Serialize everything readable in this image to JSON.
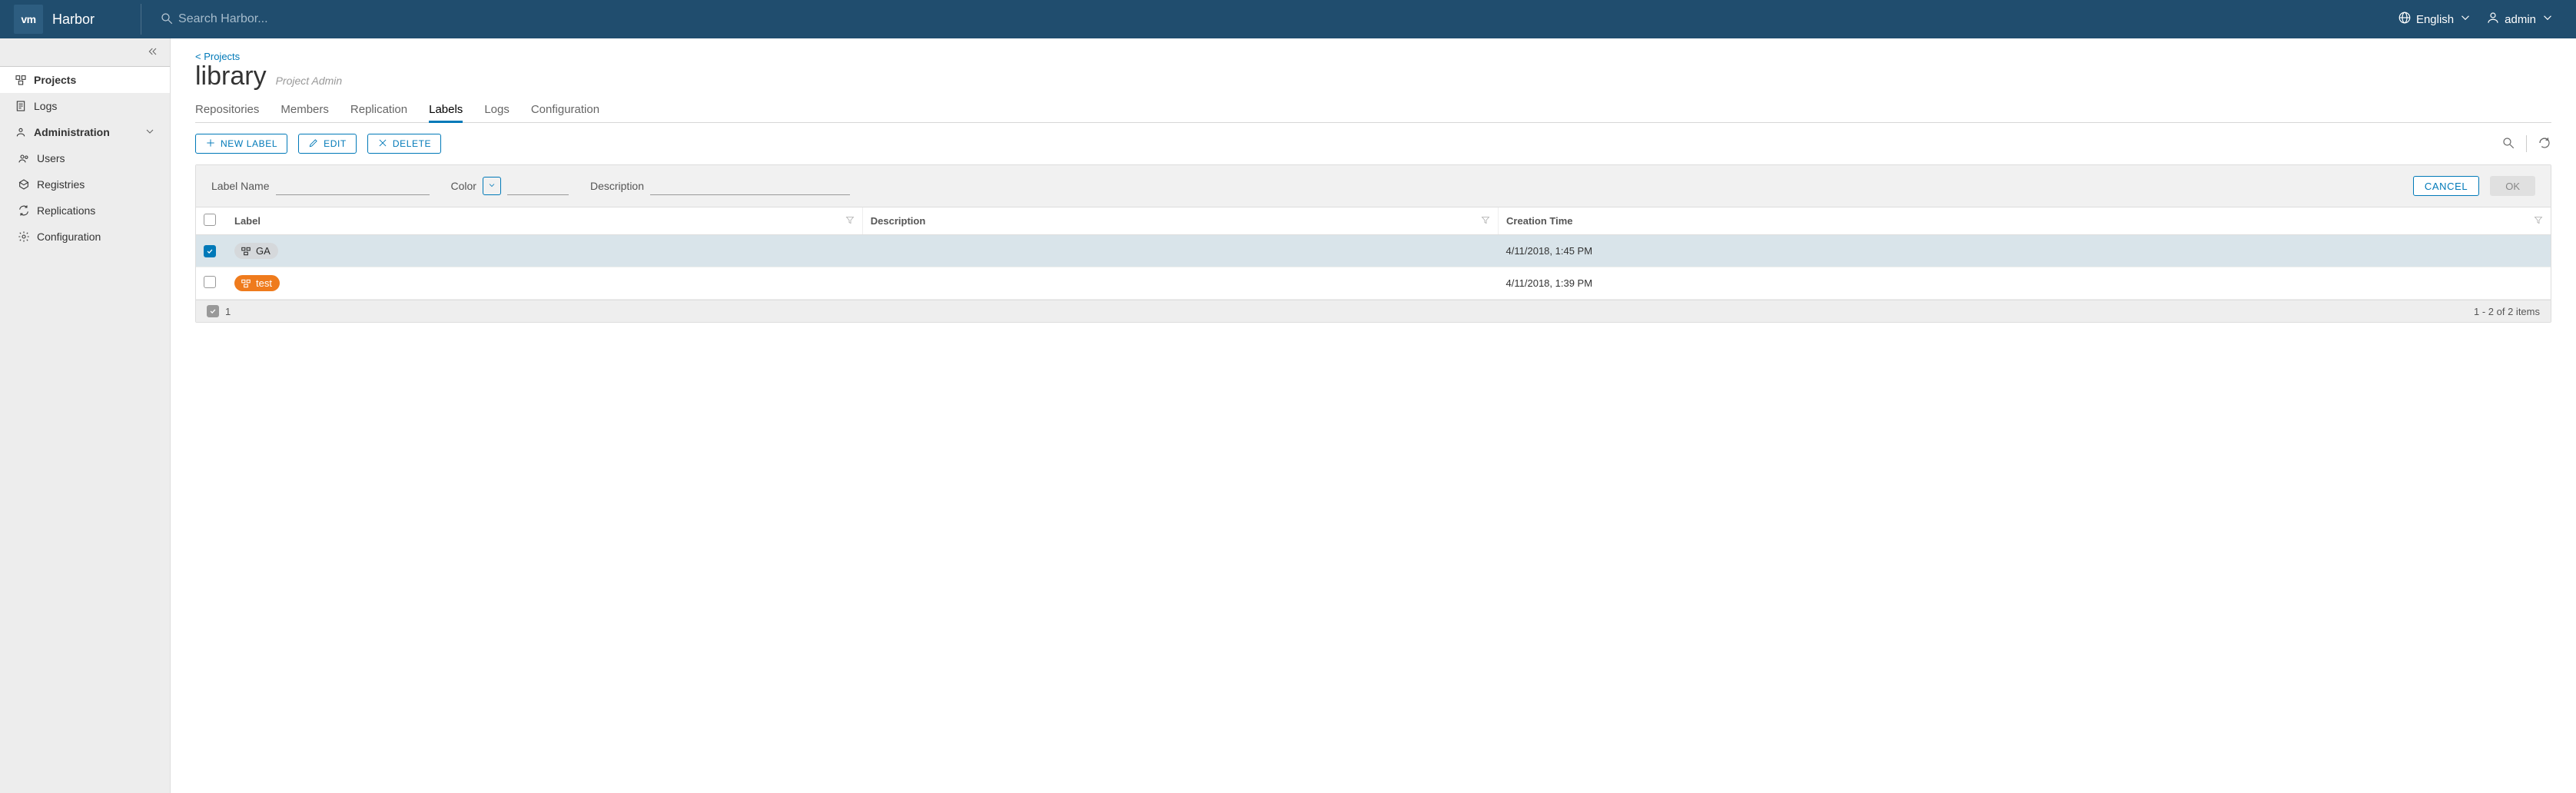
{
  "header": {
    "brand_logo_text": "vm",
    "app_name": "Harbor",
    "search_placeholder": "Search Harbor...",
    "language_label": "English",
    "user_label": "admin"
  },
  "sidebar": {
    "projects": "Projects",
    "logs": "Logs",
    "admin_label": "Administration",
    "users": "Users",
    "registries": "Registries",
    "replications": "Replications",
    "configuration": "Configuration"
  },
  "breadcrumb": {
    "back_projects": "< Projects"
  },
  "project": {
    "name": "library",
    "role": "Project Admin"
  },
  "tabs": {
    "repositories": "Repositories",
    "members": "Members",
    "replication": "Replication",
    "labels": "Labels",
    "logs": "Logs",
    "configuration": "Configuration"
  },
  "toolbar": {
    "new_label": "NEW LABEL",
    "edit": "EDIT",
    "delete": "DELETE"
  },
  "form": {
    "name_label": "Label Name",
    "color_label": "Color",
    "description_label": "Description",
    "name_value": "",
    "color_value": "",
    "description_value": "",
    "cancel": "CANCEL",
    "ok": "OK"
  },
  "table": {
    "columns": {
      "label": "Label",
      "description": "Description",
      "creation": "Creation Time"
    },
    "rows": [
      {
        "selected": true,
        "chip_text": "GA",
        "chip_color": "gray",
        "description": "",
        "created": "4/11/2018, 1:45 PM"
      },
      {
        "selected": false,
        "chip_text": "test",
        "chip_color": "orange",
        "description": "",
        "created": "4/11/2018, 1:39 PM"
      }
    ],
    "selected_count": "1",
    "range_text": "1 - 2 of 2 items"
  }
}
